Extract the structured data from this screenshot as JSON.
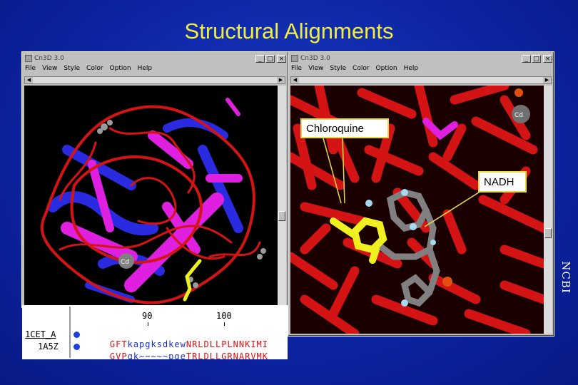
{
  "slide": {
    "title": "Structural Alignments",
    "side_label": "NCBI"
  },
  "left_window": {
    "title": "Cn3D 3.0",
    "menu": [
      "File",
      "View",
      "Style",
      "Color",
      "Option",
      "Help"
    ],
    "buttons": {
      "minimize": "_",
      "maximize": "□",
      "close": "×"
    },
    "atom_label": "Cd"
  },
  "right_window": {
    "title": "Cn3D 3.0",
    "menu": [
      "File",
      "View",
      "Style",
      "Color",
      "Option",
      "Help"
    ],
    "buttons": {
      "minimize": "_",
      "maximize": "□",
      "close": "×"
    },
    "atom_label": "Cd",
    "callouts": {
      "chloroquine": "Chloroquine",
      "nadh": "NADH"
    }
  },
  "sequence_panel": {
    "ruler": [
      "90",
      "100"
    ],
    "rows": [
      {
        "name": "1CET_A",
        "segments": [
          {
            "text": "GFT",
            "color": "#e01010"
          },
          {
            "text": "kapgksdkew",
            "color": "#1a30d0"
          },
          {
            "text": "NRLDLLPLNNKIMI",
            "color": "#e01010"
          }
        ]
      },
      {
        "name": "1A5Z",
        "segments": [
          {
            "text": "GVP",
            "color": "#e01010"
          },
          {
            "text": "qk~~~~~pge",
            "color": "#1a30d0"
          },
          {
            "text": "TRLDLLGRNARVMK",
            "color": "#e01010"
          }
        ]
      }
    ]
  },
  "colors": {
    "slide_background": "#0c23a0",
    "title": "#f2ef3a",
    "helix_red": "#d41414",
    "helix_magenta": "#e020e0",
    "helix_blue": "#2a2ae0",
    "ligand_yellow": "#f0f020",
    "nadh_gray": "#808080"
  }
}
